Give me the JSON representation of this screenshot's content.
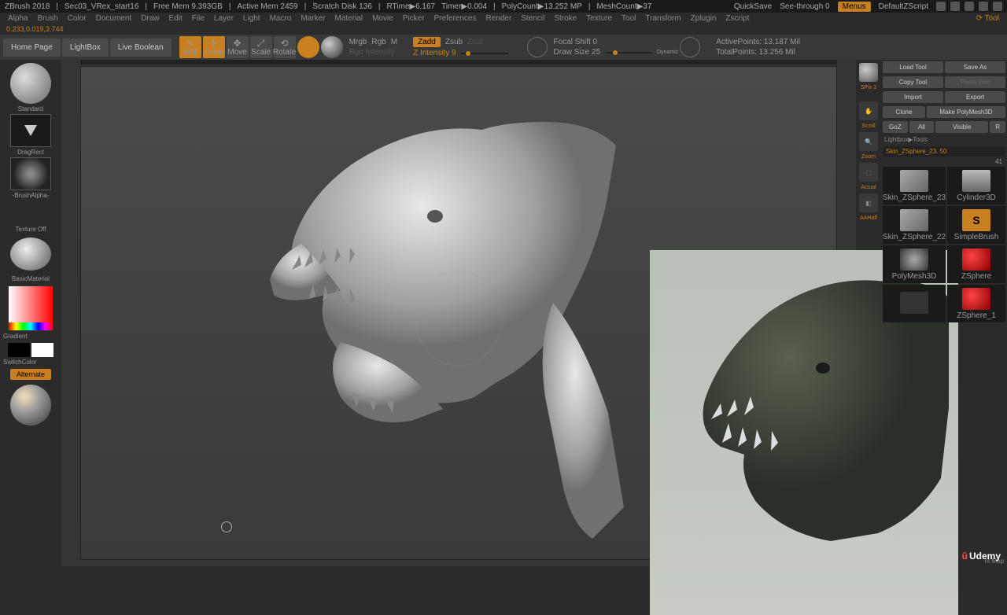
{
  "status": {
    "app": "ZBrush 2018",
    "scene": "Sec03_VRex_start16",
    "mem": "Free Mem 9.393GB",
    "active_mem": "Active Mem 2459",
    "scratch": "Scratch Disk 136",
    "rtime": "RTime▶6.167",
    "timer": "Timer▶0.004",
    "polycount": "PolyCount▶13.252 MP",
    "meshcount": "MeshCount▶37",
    "quicksave": "QuickSave",
    "seethrough": "See-through  0",
    "menus": "Menus",
    "defaultz": "DefaultZScript"
  },
  "coords": "0.233,0.019,3.744",
  "menu": [
    "Alpha",
    "Brush",
    "Color",
    "Document",
    "Draw",
    "Edit",
    "File",
    "Layer",
    "Light",
    "Macro",
    "Marker",
    "Material",
    "Movie",
    "Picker",
    "Preferences",
    "Render",
    "Stencil",
    "Stroke",
    "Texture",
    "Tool",
    "Transform",
    "Zplugin",
    "Zscript"
  ],
  "secbar": {
    "home": "Home Page",
    "lightbox": "LightBox",
    "liveboolean": "Live Boolean",
    "edit": "Edit",
    "draw": "Draw",
    "move": "Move",
    "scale": "Scale",
    "rotate": "Rotate",
    "mrgb": "Mrgb",
    "rgb": "Rgb",
    "m": "M",
    "rgb_intensity": "Rgb Intensity",
    "zadd": "Zadd",
    "zsub": "Zsub",
    "zcut": "Zcut",
    "zintensity": "Z Intensity 9",
    "focal": "Focal Shift 0",
    "drawsize": "Draw Size 25",
    "dynamic": "Dynamic",
    "active": "ActivePoints: 13.187 Mil",
    "total": "TotalPoints: 13.256 Mil"
  },
  "left": {
    "brush": "Standard",
    "stroke": "DragRect",
    "alpha": "-BrushAlpha-",
    "texture": "Texture Off",
    "material": "BasicMaterial",
    "gradient": "Gradient",
    "switch": "SwitchColor",
    "alternate": "Alternate"
  },
  "rightbar": {
    "spix": "SPix 3",
    "scroll": "Scroll",
    "zoom": "Zoom",
    "actual": "Actual",
    "aahalf": "AAHalf"
  },
  "tool": {
    "title": "Tool",
    "load": "Load Tool",
    "saveas": "Save As",
    "copy": "Copy Tool",
    "paste": "Paste Tool",
    "import": "Import",
    "export": "Export",
    "clone": "Clone",
    "makepoly": "Make PolyMesh3D",
    "goz": "GoZ",
    "all": "All",
    "visible": "Visible",
    "r": "R",
    "lightbox": "Lightbox▶Tools",
    "skin": "Skin_ZSphere_23. 50",
    "count": "41",
    "items": [
      "Skin_ZSphere_23",
      "Cylinder3D",
      "Skin_ZSphere_22",
      "SimpleBrush",
      "PolyMesh3D",
      "ZSphere",
      "",
      "ZSphere_1"
    ],
    "map": "nt Map"
  },
  "udemy": "Udemy"
}
